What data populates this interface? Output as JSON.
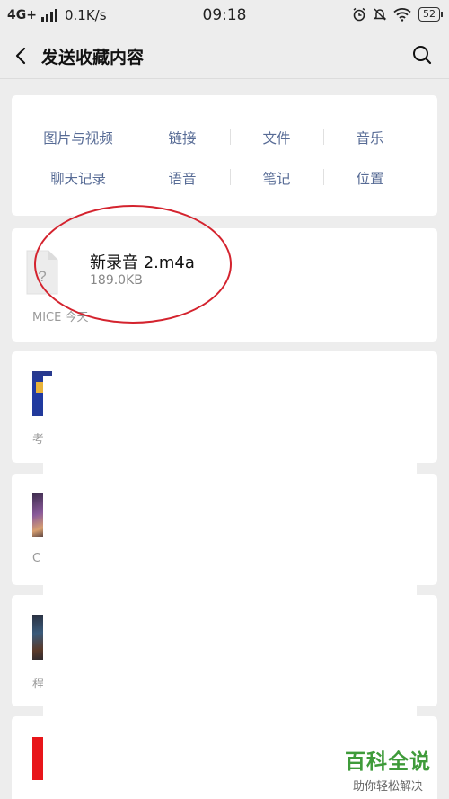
{
  "status_bar": {
    "network": "4G+",
    "speed": "0.1K/s",
    "time": "09:18",
    "battery": "52"
  },
  "nav": {
    "title": "发送收藏内容"
  },
  "categories": [
    "图片与视频",
    "链接",
    "文件",
    "音乐",
    "聊天记录",
    "语音",
    "笔记",
    "位置"
  ],
  "file_item": {
    "name": "新录音 2.m4a",
    "size": "189.0KB",
    "meta": "MICE  今天"
  },
  "items": [
    {
      "meta": "考"
    },
    {
      "meta": "C"
    },
    {
      "meta": "程"
    }
  ],
  "watermark": {
    "title": "百科全说",
    "subtitle": "助你轻松解决"
  },
  "colors": {
    "link": "#576b95",
    "annotation": "#d4232e",
    "watermark": "#3f9b3a"
  }
}
